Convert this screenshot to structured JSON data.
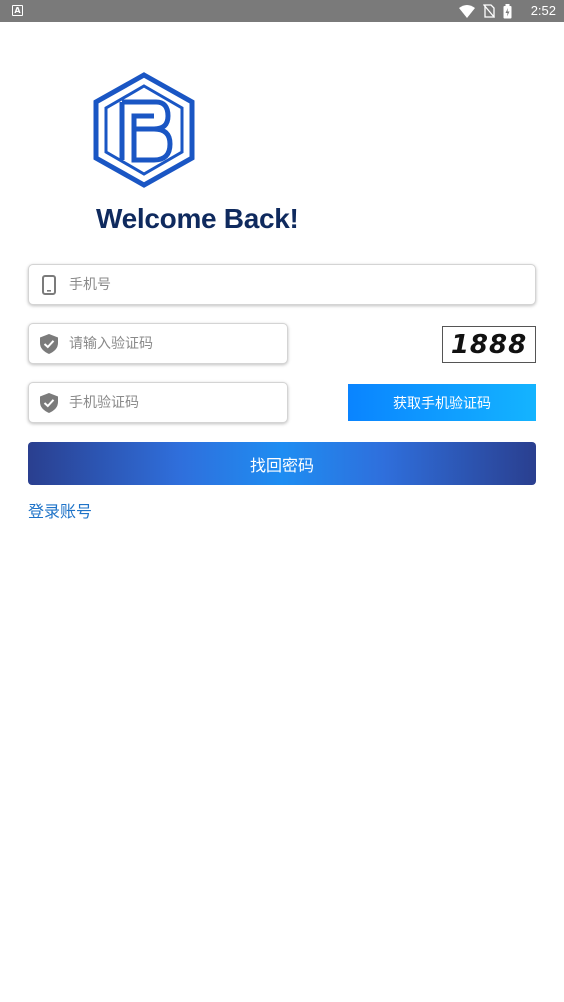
{
  "status_bar": {
    "notification_glyph": "A",
    "time": "2:52",
    "icons": [
      "wifi-icon",
      "no-sim-icon",
      "battery-charging-icon"
    ]
  },
  "header": {
    "logo_icon": "hexagon-b-logo-icon",
    "welcome": "Welcome Back!"
  },
  "form": {
    "phone_placeholder": "手机号",
    "captcha_input_placeholder": "请输入验证码",
    "captcha_image_text": "1888",
    "sms_code_placeholder": "手机验证码",
    "get_sms_button": "获取手机验证码",
    "submit_button": "找回密码",
    "login_link": "登录账号"
  },
  "colors": {
    "brand_navy": "#0f2a5e",
    "link_blue": "#1e73c8",
    "sms_button_start": "#0a84ff",
    "sms_button_end": "#14b4ff",
    "submit_dark": "#2a3f8f",
    "submit_light": "#1e8df2"
  }
}
